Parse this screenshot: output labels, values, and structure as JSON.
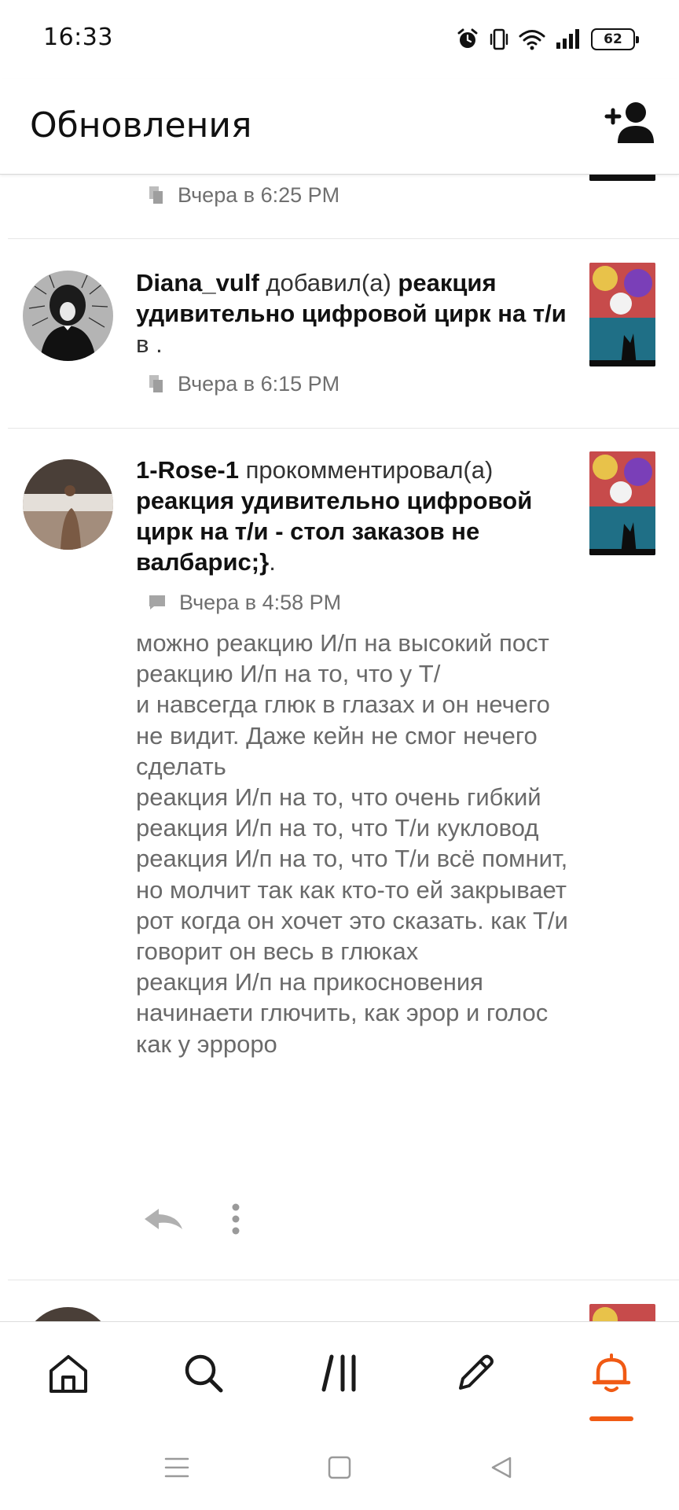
{
  "status_bar": {
    "time": "16:33",
    "battery": "62"
  },
  "header": {
    "title": "Обновления",
    "add_user_icon": "add-user-icon"
  },
  "feed": {
    "prev_item": {
      "timestamp": "Вчера в 6:25 PM"
    },
    "items": [
      {
        "user": "Diana_vulf",
        "action": "добавил(а)",
        "title": "реакция удивительно цифровой цирк на т/и",
        "suffix": "в .",
        "timestamp": "Вчера в 6:15 PM"
      },
      {
        "user": "1-Rose-1",
        "action": "прокомментировал(а)",
        "title": "реакция удивительно цифровой цирк на т/и - стол заказов не валбарис;}",
        "suffix": ".",
        "timestamp": "Вчера в 4:58 PM",
        "comment": "можно реакцию И/п на высокий пост\nреакцию И/п на то, что у Т/\nи навсегда глюк в глазах и он нечего не видит. Даже кейн не смог нечего сделать\nреакция И/п на то, что очень гибкий\nреакция И/п на то, что Т/и кукловод\nреакция И/п на то, что Т/и всё помнит, но молчит так как кто-то ей закрывает рот когда он хочет это сказать. как Т/и говорит он весь в глюках\nреакция И/п на прикосновения начинаети глючить, как эрор и голос как у эрроро"
      }
    ]
  },
  "bottom_nav": {
    "items": [
      "home-icon",
      "search-icon",
      "library-icon",
      "pencil-icon",
      "bell-icon"
    ],
    "active": "bell-icon"
  },
  "colors": {
    "accent": "#f05a14",
    "text_primary": "#111111",
    "text_secondary": "#6a6a6a"
  }
}
